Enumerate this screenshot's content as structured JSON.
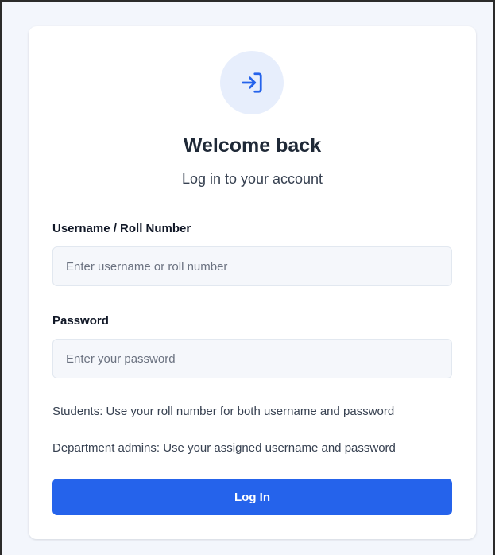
{
  "login": {
    "icon": "log-in-icon",
    "title": "Welcome back",
    "subtitle": "Log in to your account",
    "username_label": "Username / Roll Number",
    "username_placeholder": "Enter username or roll number",
    "username_value": "",
    "password_label": "Password",
    "password_placeholder": "Enter your password",
    "password_value": "",
    "hint_students": "Students: Use your roll number for both username and password",
    "hint_admins": "Department admins: Use your assigned username and password",
    "button_label": "Log In"
  },
  "colors": {
    "accent": "#2563eb",
    "icon_bg": "#e7eefc",
    "page_bg": "#f3f6fc",
    "card_bg": "#ffffff",
    "input_bg": "#f5f7fb"
  }
}
